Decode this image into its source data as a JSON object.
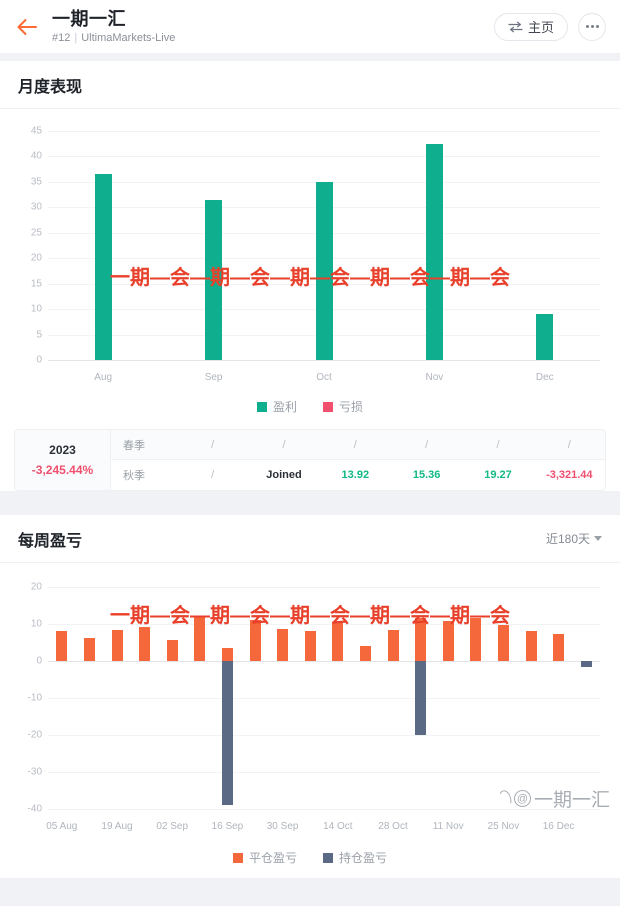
{
  "header": {
    "back_icon": "arrow-left-icon",
    "title": "一期一汇",
    "account_id": "#12",
    "separator": "|",
    "broker": "UltimaMarkets-Live",
    "home_button": "主页",
    "home_icon": "swap-arrows-icon",
    "more_icon": "more-dots-icon"
  },
  "monthly_card": {
    "title": "月度表现"
  },
  "weekly_card": {
    "title": "每周盈亏",
    "range_label": "近180天",
    "range_caret": "chevron-down-icon"
  },
  "season_table": {
    "year": "2023",
    "percent": "-3,245.44%",
    "rows": [
      {
        "label": "春季",
        "cells": [
          "/",
          "/",
          "/",
          "/",
          "/",
          "/"
        ],
        "kinds": [
          "dash",
          "dash",
          "dash",
          "dash",
          "dash",
          "dash"
        ]
      },
      {
        "label": "秋季",
        "cells": [
          "/",
          "Joined",
          "13.92",
          "15.36",
          "19.27",
          "-3,321.44"
        ],
        "kinds": [
          "dash",
          "text",
          "pos",
          "pos",
          "pos",
          "neg"
        ]
      }
    ]
  },
  "watermark": {
    "text": "一期—会—期—会—期—会—期—会—期—会",
    "brand": "@一期一汇",
    "color": "#e8402a"
  },
  "colors": {
    "profit_green": "#0fae8e",
    "loss_red": "#f0506e",
    "closed_orange": "#f4683c",
    "open_navy": "#5a6a85",
    "accent": "#ff6b35"
  },
  "chart_data": [
    {
      "type": "bar",
      "title": "月度表现",
      "categories": [
        "Aug",
        "Sep",
        "Oct",
        "Nov",
        "Dec"
      ],
      "series": [
        {
          "name": "盈利",
          "color": "#0fae8e",
          "values": [
            36.5,
            31.5,
            35.0,
            42.5,
            9.0
          ]
        },
        {
          "name": "亏损",
          "color": "#f0506e",
          "values": [
            0,
            0,
            0,
            0,
            0
          ]
        }
      ],
      "legend": [
        "盈利",
        "亏损"
      ],
      "legend_position": "bottom",
      "yticks": [
        0,
        5,
        10,
        15,
        20,
        25,
        30,
        35,
        40,
        45
      ],
      "ylim": [
        0,
        45
      ],
      "xlabel": "",
      "ylabel": "",
      "grid": true
    },
    {
      "type": "bar",
      "title": "每周盈亏",
      "x": [
        "05 Aug",
        "19 Aug",
        "02 Sep",
        "16 Sep",
        "30 Sep",
        "14 Oct",
        "28 Oct",
        "11 Nov",
        "25 Nov",
        "16 Dec"
      ],
      "xticks": [
        "05 Aug",
        "19 Aug",
        "02 Sep",
        "16 Sep",
        "30 Sep",
        "14 Oct",
        "28 Oct",
        "11 Nov",
        "25 Nov",
        "16 Dec"
      ],
      "series": [
        {
          "name": "平仓盈亏",
          "color": "#f4683c",
          "values": [
            8.0,
            6.2,
            8.4,
            9.2,
            5.8,
            11.8,
            3.6,
            11.0,
            8.6,
            8.2,
            10.6,
            4.0,
            8.4,
            11.6,
            10.8,
            11.6,
            9.8,
            8.2,
            7.2,
            0
          ]
        },
        {
          "name": "持仓盈亏",
          "color": "#5a6a85",
          "values": [
            0,
            0,
            0,
            0,
            0,
            0,
            -39.0,
            0,
            0,
            0,
            0,
            0,
            0,
            -20.0,
            0,
            0,
            0,
            0,
            0,
            -1.6
          ]
        }
      ],
      "legend": [
        "平仓盈亏",
        "持仓盈亏"
      ],
      "legend_position": "bottom",
      "yticks": [
        20,
        10,
        0,
        -10,
        -20,
        -30,
        -40
      ],
      "ylim": [
        -40,
        20
      ],
      "xlabel": "",
      "ylabel": "",
      "grid": true
    }
  ]
}
